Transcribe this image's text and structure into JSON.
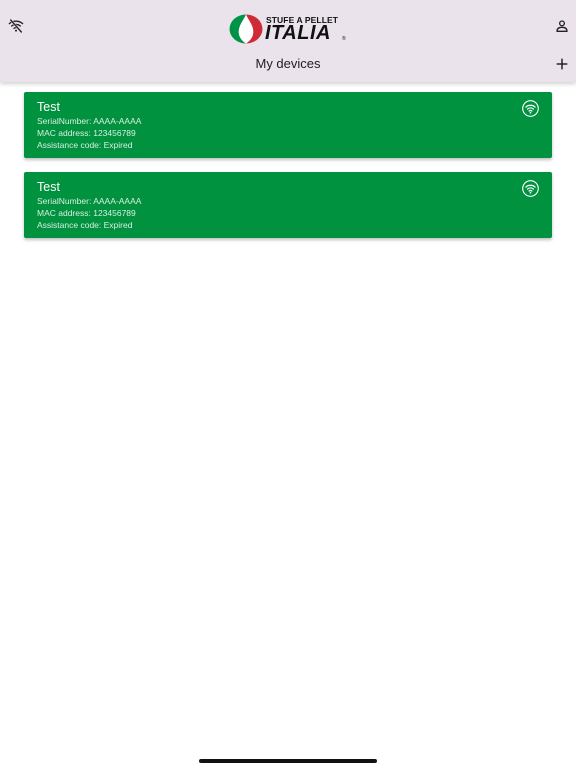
{
  "header": {
    "logo": {
      "top_text": "STUFE A PELLET",
      "main_text": "ITALIA",
      "reg_mark": "®",
      "colors": {
        "green": "#009246",
        "red": "#ce2b37",
        "white": "#ffffff"
      }
    },
    "title": "My devices",
    "left_icon": "wifi-off-icon",
    "right_icon": "person-icon",
    "add_icon": "plus-icon"
  },
  "devices": [
    {
      "name": "Test",
      "serial_line": "SerialNumber: AAAA-AAAA",
      "mac_line": "MAC address: 123456789",
      "assistance_line": "Assistance code: Expired",
      "status_icon": "wifi-icon"
    },
    {
      "name": "Test",
      "serial_line": "SerialNumber: AAAA-AAAA",
      "mac_line": "MAC address: 123456789",
      "assistance_line": "Assistance code: Expired",
      "status_icon": "wifi-icon"
    }
  ],
  "theme": {
    "header_bg": "#eae3ec",
    "card_bg": "#00923f",
    "card_text": "#ffffff"
  }
}
